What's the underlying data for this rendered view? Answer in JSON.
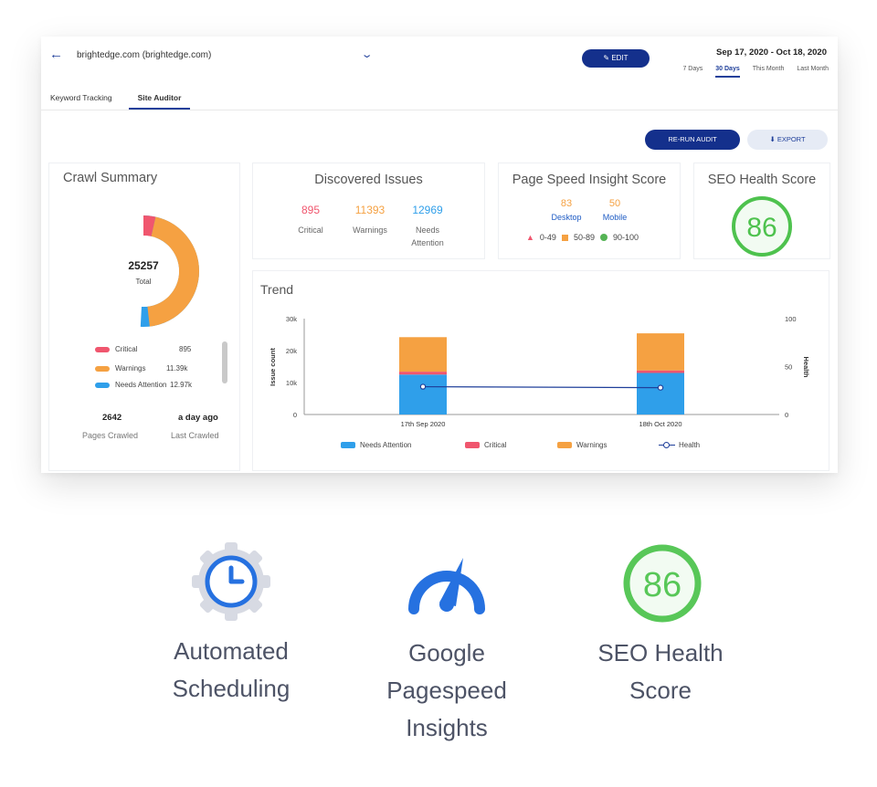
{
  "header": {
    "site": "brightedge.com (brightedge.com)",
    "edit_label": "EDIT",
    "date_range": "Sep 17, 2020 - Oct 18, 2020",
    "range_options": [
      "7 Days",
      "30 Days",
      "This Month",
      "Last Month"
    ],
    "range_selected": "30 Days"
  },
  "tabs": [
    "Keyword Tracking",
    "Site Auditor"
  ],
  "tab_selected": "Site Auditor",
  "actions": {
    "rerun": "RE-RUN AUDIT",
    "export": "EXPORT"
  },
  "crawl_summary": {
    "title": "Crawl Summary",
    "total": "25257",
    "total_label": "Total",
    "legend": [
      {
        "label": "Critical",
        "value": "895",
        "color": "#f0566e"
      },
      {
        "label": "Warnings",
        "value": "11.39k",
        "color": "#f5a142"
      },
      {
        "label": "Needs Attention",
        "value": "12.97k",
        "color": "#2f9fea"
      }
    ],
    "pages_crawled": "2642",
    "pages_crawled_label": "Pages Crawled",
    "last_crawled": "a day ago",
    "last_crawled_label": "Last Crawled"
  },
  "discovered_issues": {
    "title": "Discovered Issues",
    "items": [
      {
        "value": "895",
        "label": "Critical",
        "color": "#f0566e"
      },
      {
        "value": "11393",
        "label": "Warnings",
        "color": "#f5a142"
      },
      {
        "value": "12969",
        "label": "Needs Attention",
        "color": "#2f9fea"
      }
    ]
  },
  "page_speed": {
    "title": "Page Speed Insight Score",
    "desktop_value": "83",
    "desktop_label": "Desktop",
    "mobile_value": "50",
    "mobile_label": "Mobile",
    "legend": [
      "0-49",
      "50-89",
      "90-100"
    ]
  },
  "seo_health": {
    "title": "SEO Health Score",
    "score": "86"
  },
  "chart_data": {
    "type": "bar",
    "title": "Trend",
    "categories": [
      "17th Sep 2020",
      "18th Oct 2020"
    ],
    "stacked": true,
    "series": [
      {
        "name": "Needs Attention",
        "values": [
          12500,
          13000
        ],
        "color": "#2f9fea"
      },
      {
        "name": "Critical",
        "values": [
          900,
          800
        ],
        "color": "#f0566e"
      },
      {
        "name": "Warnings",
        "values": [
          10800,
          11600
        ],
        "color": "#f5a142"
      }
    ],
    "line_series": {
      "name": "Health",
      "values": [
        29,
        28
      ],
      "axis": "right",
      "color": "#1f3f9a"
    },
    "ylabel": "Issue count",
    "y2label": "Health",
    "ylim": [
      0,
      30000
    ],
    "y2lim": [
      0,
      100
    ],
    "y_ticks": [
      "0",
      "10k",
      "20k",
      "30k"
    ],
    "y2_ticks": [
      "0",
      "50",
      "100"
    ]
  },
  "features": [
    {
      "label": "Automated Scheduling",
      "icon": "gear-clock-icon"
    },
    {
      "label": "Google Pagespeed Insights",
      "icon": "speedometer-icon"
    },
    {
      "label": "SEO Health Score",
      "icon": "score-ring-icon",
      "score": "86"
    }
  ]
}
